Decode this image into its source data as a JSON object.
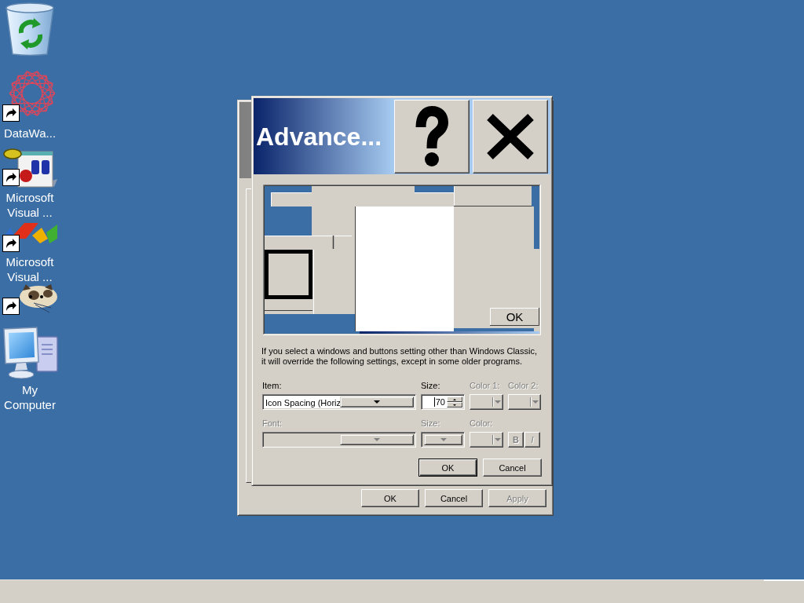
{
  "desktop": {
    "icons": [
      {
        "kind": "recycle-bin",
        "shortcut": false
      },
      {
        "kind": "network",
        "shortcut": true,
        "label": "DataWa..."
      },
      {
        "kind": "calendar",
        "shortcut": true,
        "label": "Microsoft Visual ..."
      },
      {
        "kind": "shapes",
        "shortcut": true,
        "label": "Microsoft Visual ..."
      },
      {
        "kind": "cat",
        "shortcut": true
      },
      {
        "kind": "computer",
        "shortcut": false,
        "label": "My Computer"
      }
    ]
  },
  "properties_window": {
    "buttons": [
      {
        "label": "OK",
        "disabled": false
      },
      {
        "label": "Cancel",
        "disabled": false
      },
      {
        "label": "Apply",
        "disabled": true
      }
    ]
  },
  "dialog": {
    "title": "Advance...",
    "caption_buttons": [
      {
        "kind": "help"
      },
      {
        "kind": "close"
      }
    ],
    "preview": {
      "button": "OK"
    },
    "notice": "If you select a windows and buttons setting other than Windows Classic, it will override the following settings, except in some older programs.",
    "rows": [
      [
        {
          "kind": "combo",
          "label": "Item:",
          "value": "Icon Spacing (Horiz",
          "disabled": false
        },
        {
          "kind": "spin",
          "label": "Size:",
          "value": "70",
          "focused": true,
          "disabled": false
        },
        {
          "kind": "color",
          "label": "Color 1:",
          "disabled": true
        },
        {
          "kind": "color",
          "label": "Color 2:",
          "disabled": true
        }
      ],
      [
        {
          "kind": "combo",
          "label": "Font:",
          "disabled": true
        },
        {
          "kind": "combo",
          "label": "Size:",
          "disabled": true
        },
        {
          "kind": "color",
          "label": "Color:",
          "disabled": true
        },
        {
          "kind": "styles",
          "buttons": [
            {
              "kind": "bold",
              "label": "B",
              "disabled": true
            },
            {
              "kind": "italic",
              "label": "I",
              "disabled": true
            }
          ]
        }
      ]
    ],
    "buttons": [
      {
        "label": "OK",
        "default": true
      },
      {
        "label": "Cancel",
        "default": false
      }
    ]
  }
}
